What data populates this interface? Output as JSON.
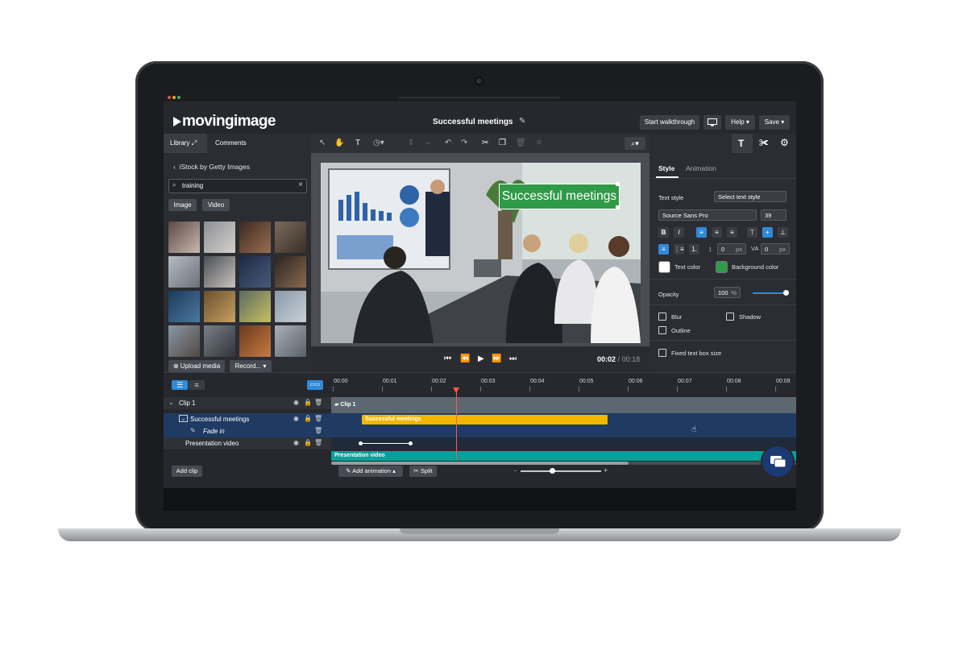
{
  "app": {
    "logo": "movingimage",
    "project_title": "Successful meetings"
  },
  "header": {
    "start_walkthrough": "Start walkthrough",
    "help": "Help ▾",
    "save": "Save ▾"
  },
  "left_panel": {
    "tabs": [
      "Library",
      "Comments"
    ],
    "back_label": "iStock by Getty Images",
    "search_value": "training",
    "filters": [
      "Image",
      "Video"
    ],
    "upload_media": "Upload media",
    "record": "Record... ▾"
  },
  "preview": {
    "overlay_text": "Successful meetings",
    "current_time": "00:02",
    "separator": "/",
    "total_time": "00:18"
  },
  "right_panel": {
    "tabs": [
      "Style",
      "Animation"
    ],
    "text_style_label": "Text style",
    "text_style_value": "Select text style",
    "font_value": "Source Sans Pro",
    "font_size": "39",
    "spacing_1": "0",
    "spacing_2": "0",
    "unit": "px",
    "text_color_label": "Text color",
    "background_color_label": "Background color",
    "text_color": "#ffffff",
    "background_color": "#2f9a47",
    "opacity_label": "Opacity",
    "opacity_value": "100",
    "opacity_unit": "%",
    "opacity_level": 1.0,
    "checkboxes": {
      "blur": "Blur",
      "shadow": "Shadow",
      "outline": "Outline",
      "fixed": "Fixed text box size"
    }
  },
  "timeline": {
    "ticks": [
      "00:00",
      "00:01",
      "00:02",
      "00:03",
      "00:04",
      "00:05",
      "00:06",
      "00:07",
      "00:08",
      "00:09"
    ],
    "rows": {
      "clip": "Clip 1",
      "text": "Successful meetings",
      "fade": "Fade in",
      "video": "Presentation video"
    },
    "tracks": {
      "clip": "Clip 1",
      "text": "Successful meetings",
      "video": "Presentation video"
    },
    "add_clip": "Add clip",
    "add_animation": "Add animation ▴",
    "split": "Split",
    "zoom_minus": "-",
    "zoom_plus": "+"
  },
  "colors": {
    "accent": "#2f8bd8",
    "playhead": "#ff5a47",
    "text_track": "#f2b600",
    "video_track": "#00a39a"
  }
}
